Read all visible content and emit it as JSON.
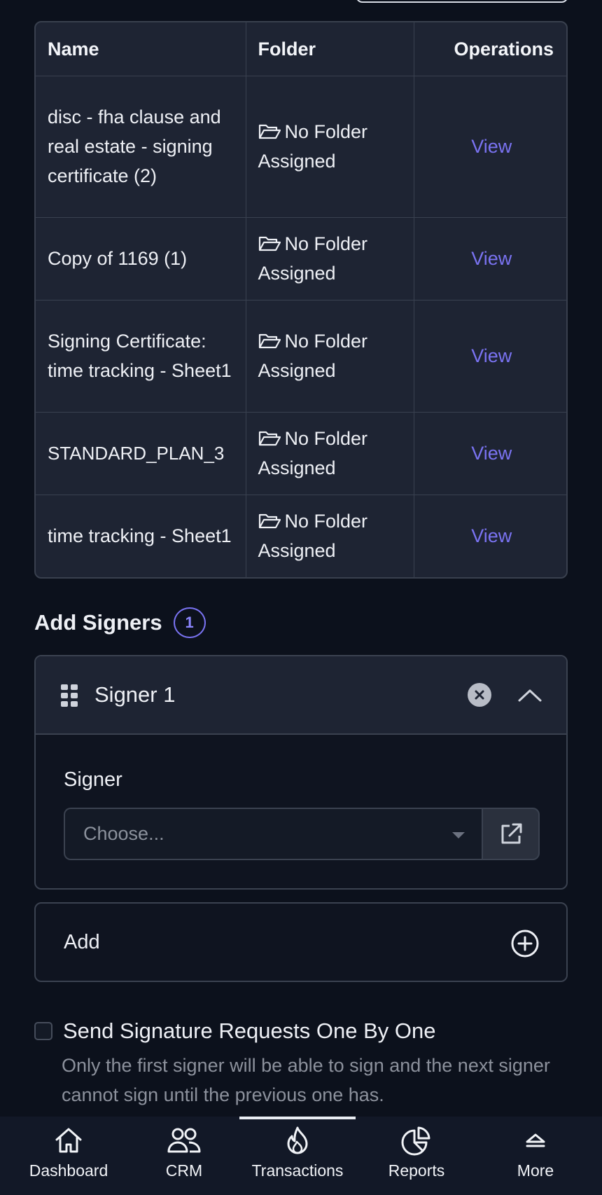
{
  "table": {
    "headers": {
      "name": "Name",
      "folder": "Folder",
      "operations": "Operations"
    },
    "rows": [
      {
        "name": "disc - fha clause and real estate - signing certificate (2)",
        "folder": "No Folder Assigned",
        "action": "View"
      },
      {
        "name": "Copy of 1169 (1)",
        "folder": "No Folder Assigned",
        "action": "View"
      },
      {
        "name": "Signing Certificate: time tracking - Sheet1",
        "folder": "No Folder Assigned",
        "action": "View"
      },
      {
        "name": "STANDARD_PLAN_3",
        "folder": "No Folder Assigned",
        "action": "View"
      },
      {
        "name": "time tracking - Sheet1",
        "folder": "No Folder Assigned",
        "action": "View"
      }
    ]
  },
  "signers": {
    "title": "Add Signers",
    "count": "1",
    "items": [
      {
        "title": "Signer 1",
        "field_label": "Signer",
        "select_placeholder": "Choose..."
      }
    ],
    "add_label": "Add"
  },
  "options": {
    "one_by_one_label": "Send Signature Requests One By One",
    "one_by_one_help": "Only the first signer will be able to sign and the next signer cannot sign until the previous one has.",
    "one_by_one_checked": false
  },
  "nav": {
    "items": [
      {
        "label": "Dashboard",
        "icon": "home-icon"
      },
      {
        "label": "CRM",
        "icon": "users-icon"
      },
      {
        "label": "Transactions",
        "icon": "flame-icon",
        "active": true
      },
      {
        "label": "Reports",
        "icon": "pie-chart-icon"
      },
      {
        "label": "More",
        "icon": "chevron-up-icon"
      }
    ]
  },
  "colors": {
    "accent": "#7a73f2",
    "background": "#0c111c",
    "surface": "#1e2433"
  }
}
